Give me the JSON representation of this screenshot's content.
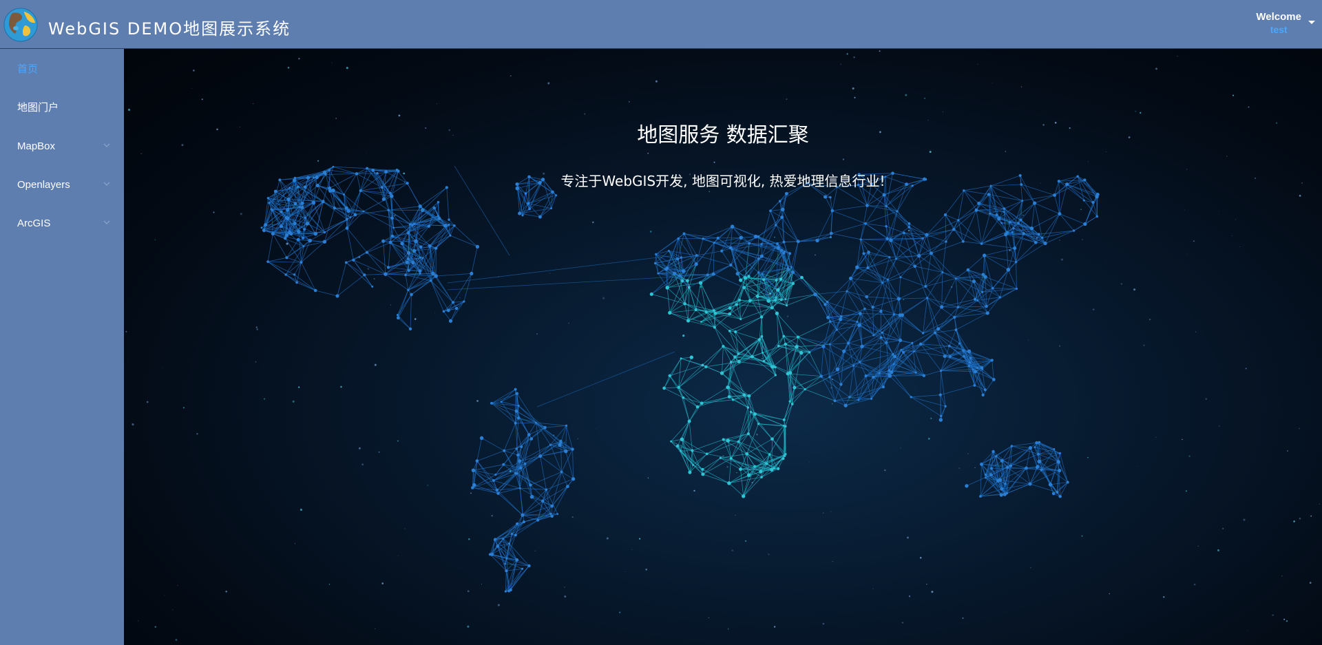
{
  "header": {
    "title": "WebGIS DEMO地图展示系统",
    "logo_icon": "globe-icon",
    "welcome_label": "Welcome",
    "username": "test",
    "caret_icon": "caret-down-icon"
  },
  "sidebar": {
    "items": [
      {
        "label": "首页",
        "active": true,
        "expandable": false
      },
      {
        "label": "地图门户",
        "active": false,
        "expandable": false
      },
      {
        "label": "MapBox",
        "active": false,
        "expandable": true
      },
      {
        "label": "Openlayers",
        "active": false,
        "expandable": true
      },
      {
        "label": "ArcGIS",
        "active": false,
        "expandable": true
      }
    ]
  },
  "main": {
    "title": "地图服务 数据汇聚",
    "subtitle": "专注于WebGIS开发, 地图可视化, 热爱地理信息行业!",
    "background": "world-map-network-background"
  },
  "colors": {
    "bar_bg": "#5e7eb0",
    "active_text": "#4aa8ff",
    "text": "#ffffff",
    "canvas_dark": "#030a14",
    "network_blue": "#1e6fc4",
    "network_cyan": "#22b5c8"
  }
}
